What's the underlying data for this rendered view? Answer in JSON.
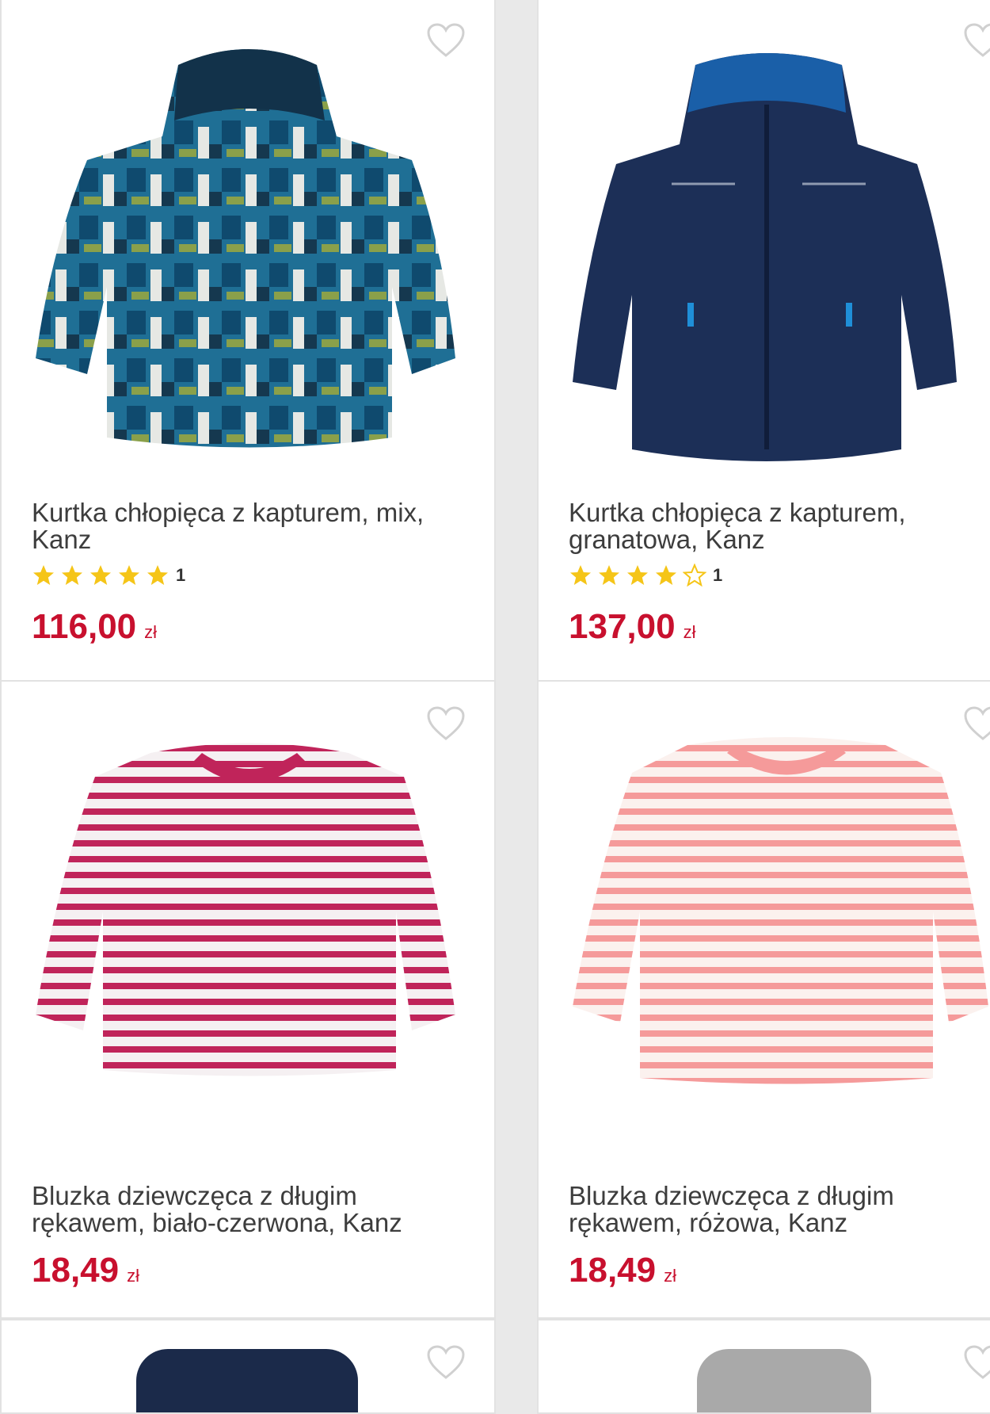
{
  "products": [
    {
      "title": "Kurtka chłopięca z kapturem, mix, Kanz",
      "rating_count": "1",
      "rating": 5,
      "price": "116,00",
      "currency": "zł",
      "image": "jacket-blue-mix-image"
    },
    {
      "title": "Kurtka chłopięca z kapturem, granatowa, Kanz",
      "rating_count": "1",
      "rating": 4,
      "price": "137,00",
      "currency": "zł",
      "image": "jacket-navy-image"
    },
    {
      "title": "Bluzka dziewczęca z długim rękawem, biało-czerwona, Kanz",
      "price": "18,49",
      "currency": "zł",
      "image": "shirt-red-stripe-image"
    },
    {
      "title": "Bluzka dziewczęca z długim rękawem, różowa, Kanz",
      "price": "18,49",
      "currency": "zł",
      "image": "shirt-pink-stripe-image"
    }
  ],
  "icons": {
    "favorite": "heart-outline-icon",
    "star_full": "star-filled-icon",
    "star_empty": "star-outline-icon"
  },
  "colors": {
    "price": "#c8102e",
    "star": "#f5c518",
    "heart_outline": "#d0d0d0"
  }
}
